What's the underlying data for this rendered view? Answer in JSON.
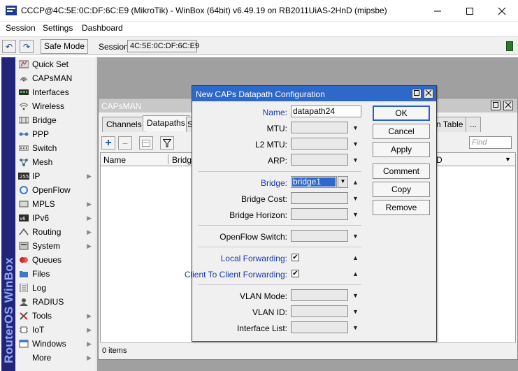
{
  "window": {
    "title": "CCCP@4C:5E:0C:DF:6C:E9 (MikroTik) - WinBox (64bit) v6.49.19 on RB2011UiAS-2HnD (mipsbe)",
    "controls": [
      "minimize-icon",
      "maximize-icon",
      "close-icon"
    ]
  },
  "menu": [
    "Session",
    "Settings",
    "Dashboard"
  ],
  "toolbar": {
    "undo_icon": "undo-icon",
    "redo_icon": "redo-icon",
    "safe_mode_label": "Safe Mode",
    "session_label": "Session:",
    "session_value": "4C:5E:0C:DF:6C:E9",
    "status_color": "#2d7a2d"
  },
  "brand": "RouterOS WinBox",
  "nav": {
    "items": [
      {
        "label": "Quick Set",
        "icon": "quick-set-icon",
        "submenu": false
      },
      {
        "label": "CAPsMAN",
        "icon": "capsman-icon",
        "submenu": false
      },
      {
        "label": "Interfaces",
        "icon": "interfaces-icon",
        "submenu": false
      },
      {
        "label": "Wireless",
        "icon": "wireless-icon",
        "submenu": false
      },
      {
        "label": "Bridge",
        "icon": "bridge-icon",
        "submenu": false
      },
      {
        "label": "PPP",
        "icon": "ppp-icon",
        "submenu": false
      },
      {
        "label": "Switch",
        "icon": "switch-icon",
        "submenu": false
      },
      {
        "label": "Mesh",
        "icon": "mesh-icon",
        "submenu": false
      },
      {
        "label": "IP",
        "icon": "ip-icon",
        "submenu": true
      },
      {
        "label": "OpenFlow",
        "icon": "openflow-icon",
        "submenu": false
      },
      {
        "label": "MPLS",
        "icon": "mpls-icon",
        "submenu": true
      },
      {
        "label": "IPv6",
        "icon": "ipv6-icon",
        "submenu": true
      },
      {
        "label": "Routing",
        "icon": "routing-icon",
        "submenu": true
      },
      {
        "label": "System",
        "icon": "system-icon",
        "submenu": true
      },
      {
        "label": "Queues",
        "icon": "queues-icon",
        "submenu": false
      },
      {
        "label": "Files",
        "icon": "files-icon",
        "submenu": false
      },
      {
        "label": "Log",
        "icon": "log-icon",
        "submenu": false
      },
      {
        "label": "RADIUS",
        "icon": "radius-icon",
        "submenu": false
      },
      {
        "label": "Tools",
        "icon": "tools-icon",
        "submenu": true
      },
      {
        "label": "IoT",
        "icon": "iot-icon",
        "submenu": true
      },
      {
        "label": "Windows",
        "icon": "windows-icon",
        "submenu": true
      },
      {
        "label": "More",
        "icon": "",
        "submenu": true
      }
    ]
  },
  "capsman": {
    "title": "CAPsMAN",
    "tabs": [
      "Channels",
      "Datapaths",
      "S",
      "n Table",
      "..."
    ],
    "active_tab": "Datapaths",
    "find_placeholder": "Find",
    "columns": [
      "Name",
      "Bridge",
      "D"
    ],
    "status": "0 items"
  },
  "dialog": {
    "title": "New CAPs Datapath Configuration",
    "fields": {
      "name": {
        "label": "Name:",
        "value": "datapath24"
      },
      "mtu": {
        "label": "MTU:",
        "value": ""
      },
      "l2mtu": {
        "label": "L2 MTU:",
        "value": ""
      },
      "arp": {
        "label": "ARP:",
        "value": ""
      },
      "bridge": {
        "label": "Bridge:",
        "value": "bridge1"
      },
      "bridge_cost": {
        "label": "Bridge Cost:",
        "value": ""
      },
      "bridge_horizon": {
        "label": "Bridge Horizon:",
        "value": ""
      },
      "openflow_switch": {
        "label": "OpenFlow Switch:",
        "value": ""
      },
      "local_forwarding": {
        "label": "Local Forwarding:",
        "checked": true
      },
      "client_to_client": {
        "label": "Client To Client Forwarding:",
        "checked": true
      },
      "vlan_mode": {
        "label": "VLAN Mode:",
        "value": ""
      },
      "vlan_id": {
        "label": "VLAN ID:",
        "value": ""
      },
      "interface_list": {
        "label": "Interface List:",
        "value": ""
      }
    },
    "buttons": [
      "OK",
      "Cancel",
      "Apply",
      "Comment",
      "Copy",
      "Remove"
    ]
  }
}
